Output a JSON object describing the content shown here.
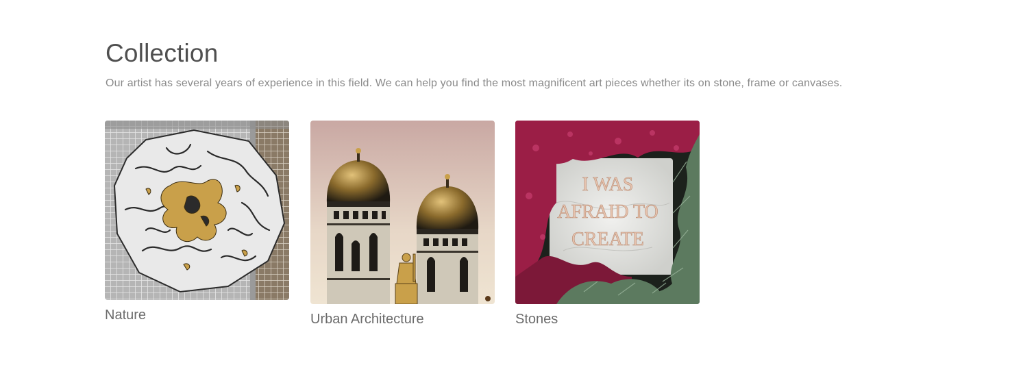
{
  "collection": {
    "title": "Collection",
    "description": "Our artist has several years of experience in this field. We can help you find the most magnificent art pieces whether its on stone, frame or canvases."
  },
  "cards": [
    {
      "label": "Nature",
      "image": "nature-artwork"
    },
    {
      "label": "Urban Architecture",
      "image": "urban-architecture-artwork"
    },
    {
      "label": "Stones",
      "image": "stones-artwork",
      "engraving": [
        "I WAS",
        "AFRAID TO",
        "CREATE"
      ]
    }
  ],
  "colors": {
    "title": "#4f4f4f",
    "description": "#8a8a8a",
    "label": "#6b6b6b",
    "gold": "#c9a04a",
    "heather": "#9b1e46",
    "fir": "#5c7a5f"
  }
}
